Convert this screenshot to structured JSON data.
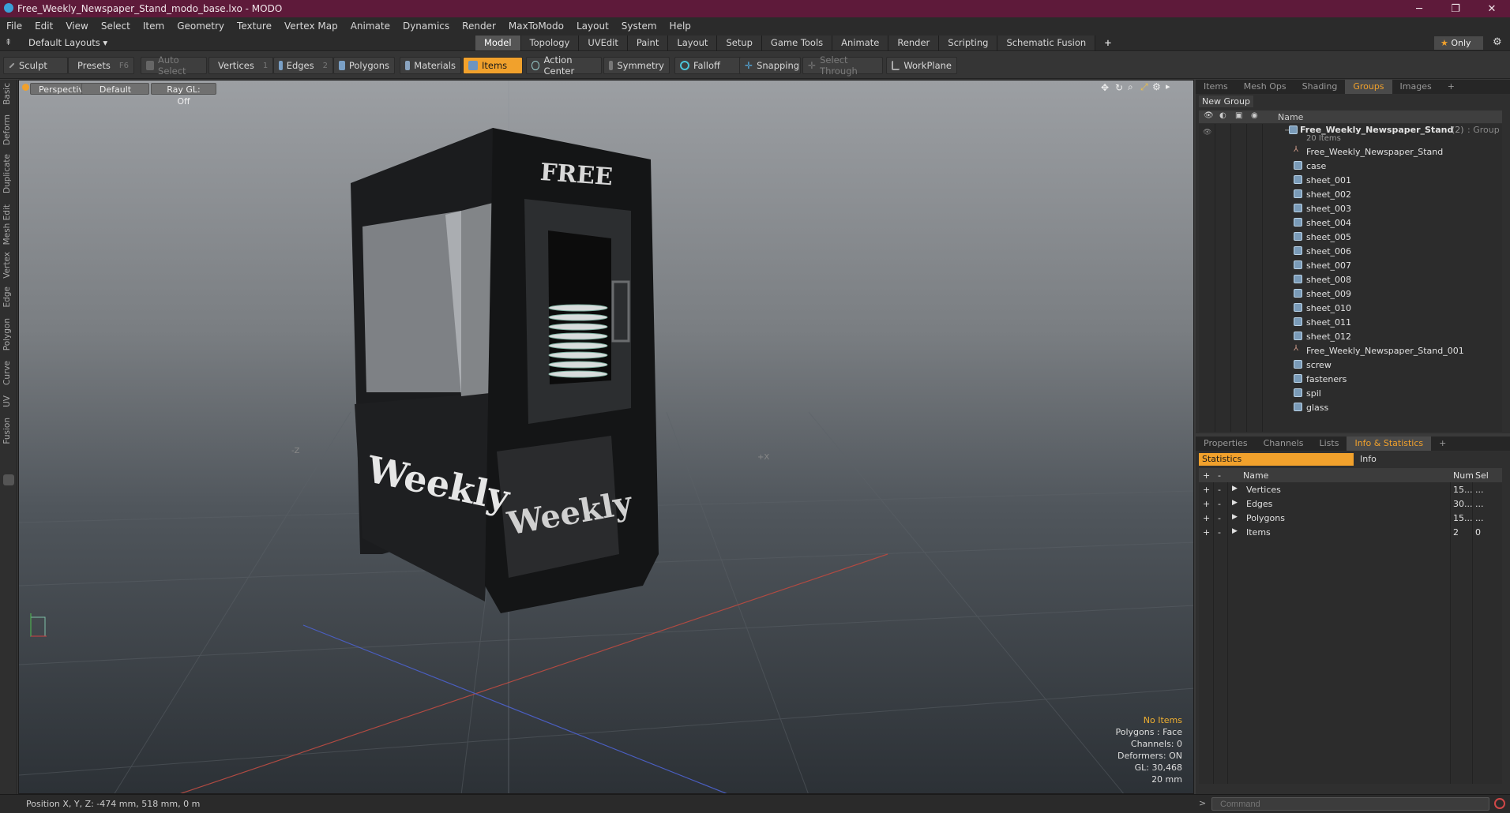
{
  "window": {
    "title": "Free_Weekly_Newspaper_Stand_modo_base.lxo - MODO"
  },
  "menu": [
    "File",
    "Edit",
    "View",
    "Select",
    "Item",
    "Geometry",
    "Texture",
    "Vertex Map",
    "Animate",
    "Dynamics",
    "Render",
    "MaxToModo",
    "Layout",
    "System",
    "Help"
  ],
  "layout_selector": "Default Layouts",
  "layout_tabs": [
    "Model",
    "Topology",
    "UVEdit",
    "Paint",
    "Layout",
    "Setup",
    "Game Tools",
    "Animate",
    "Render",
    "Scripting",
    "Schematic Fusion"
  ],
  "only_label": "Only",
  "toolbar": {
    "sculpt": "Sculpt",
    "presets": "Presets",
    "presets_key": "F6",
    "auto_select": "Auto Select",
    "vertices": "Vertices",
    "vertices_key": "1",
    "edges": "Edges",
    "edges_key": "2",
    "polygons": "Polygons",
    "materials": "Materials",
    "items": "Items",
    "action_center": "Action Center",
    "symmetry": "Symmetry",
    "falloff": "Falloff",
    "snapping": "Snapping",
    "select_through": "Select Through",
    "workplane": "WorkPlane"
  },
  "left_strip": [
    "Basic",
    "Deform",
    "Duplicate",
    "Mesh Edit",
    "Vertex",
    "Edge",
    "Polygon",
    "Curve",
    "UV",
    "Fusion"
  ],
  "viewport": {
    "view": "Perspective",
    "shading": "Default",
    "raygl": "Ray GL: Off",
    "stats": {
      "no_items": "No Items",
      "polygons": "Polygons : Face",
      "channels": "Channels: 0",
      "deformers": "Deformers: ON",
      "gl": "GL: 30,468",
      "scale": "20 mm"
    },
    "model_text": {
      "free": "FREE",
      "weekly_side": "Weekly",
      "weekly_front": "Weekly"
    },
    "axis_labels": {
      "neg_z": "-Z",
      "pos_x": "+X"
    }
  },
  "status": {
    "position": "Position X, Y, Z:  -474 mm, 518 mm, 0 m",
    "command_placeholder": "Command"
  },
  "top_panel": {
    "tabs": [
      "Items",
      "Mesh Ops",
      "Shading",
      "Groups",
      "Images"
    ],
    "active_tab": "Groups",
    "new_group": "New Group",
    "name_header": "Name",
    "group": {
      "name": "Free_Weekly_Newspaper_Stand",
      "count": "(2)",
      "type": ": Group",
      "items_count": "20 Items"
    },
    "items": [
      "Free_Weekly_Newspaper_Stand",
      "case",
      "sheet_001",
      "sheet_002",
      "sheet_003",
      "sheet_004",
      "sheet_005",
      "sheet_006",
      "sheet_007",
      "sheet_008",
      "sheet_009",
      "sheet_010",
      "sheet_011",
      "sheet_012",
      "Free_Weekly_Newspaper_Stand_001",
      "screw",
      "fasteners",
      "spil",
      "glass"
    ]
  },
  "bottom_panel": {
    "tabs": [
      "Properties",
      "Channels",
      "Lists",
      "Info & Statistics"
    ],
    "active_tab": "Info & Statistics",
    "statistics": "Statistics",
    "info": "Info",
    "headers": {
      "name": "Name",
      "num": "Num",
      "sel": "Sel"
    },
    "rows": [
      {
        "name": "Vertices",
        "num": "15...",
        "sel": "..."
      },
      {
        "name": "Edges",
        "num": "30...",
        "sel": "..."
      },
      {
        "name": "Polygons",
        "num": "15...",
        "sel": "..."
      },
      {
        "name": "Items",
        "num": "2",
        "sel": "0"
      }
    ]
  },
  "colors": {
    "title_bar": "#5e1a3a",
    "accent": "#f1a12c"
  }
}
